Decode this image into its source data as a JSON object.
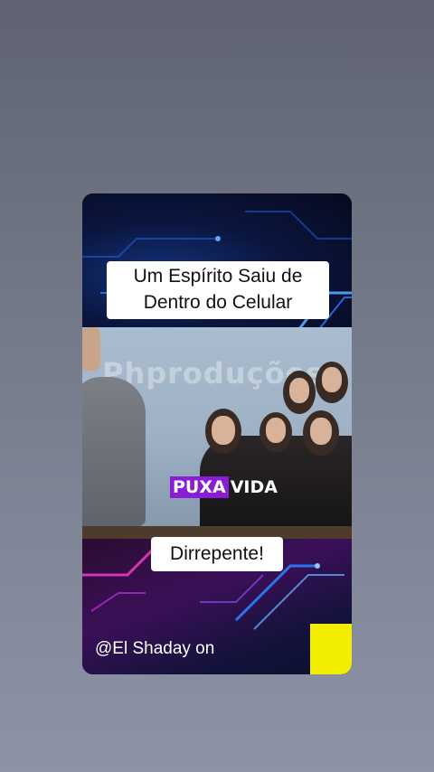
{
  "card": {
    "title_lines": [
      "Um Espírito Saiu de",
      "Dentro do Celular"
    ],
    "video_watermark": "Phproduções",
    "overlay_highlight": "PUXA",
    "overlay_rest": "VIDA",
    "bottom_caption": "Dirrepente!",
    "handle": "@El Shaday on"
  },
  "colors": {
    "highlight": "#8a1cd6",
    "accent_square": "#f3ee00",
    "top_glow": "#2f7dff",
    "bottom_glow": "#ff3fd2"
  }
}
